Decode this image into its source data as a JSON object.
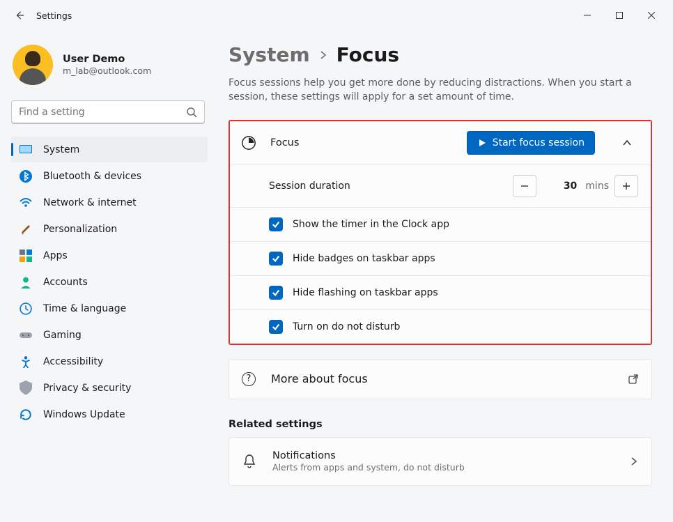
{
  "window": {
    "title": "Settings"
  },
  "profile": {
    "name": "User Demo",
    "email": "m_lab@outlook.com"
  },
  "search": {
    "placeholder": "Find a setting"
  },
  "nav": {
    "items": [
      {
        "label": "System"
      },
      {
        "label": "Bluetooth & devices"
      },
      {
        "label": "Network & internet"
      },
      {
        "label": "Personalization"
      },
      {
        "label": "Apps"
      },
      {
        "label": "Accounts"
      },
      {
        "label": "Time & language"
      },
      {
        "label": "Gaming"
      },
      {
        "label": "Accessibility"
      },
      {
        "label": "Privacy & security"
      },
      {
        "label": "Windows Update"
      }
    ]
  },
  "breadcrumb": {
    "parent": "System",
    "current": "Focus"
  },
  "description": "Focus sessions help you get more done by reducing distractions. When you start a session, these settings will apply for a set amount of time.",
  "focus": {
    "label": "Focus",
    "start_button": "Start focus session",
    "session_duration_label": "Session duration",
    "duration_value": "30",
    "duration_unit": "mins",
    "options": [
      {
        "label": "Show the timer in the Clock app",
        "checked": true
      },
      {
        "label": "Hide badges on taskbar apps",
        "checked": true
      },
      {
        "label": "Hide flashing on taskbar apps",
        "checked": true
      },
      {
        "label": "Turn on do not disturb",
        "checked": true
      }
    ]
  },
  "more_about": "More about focus",
  "related": {
    "heading": "Related settings",
    "notifications": {
      "title": "Notifications",
      "subtitle": "Alerts from apps and system, do not disturb"
    }
  }
}
